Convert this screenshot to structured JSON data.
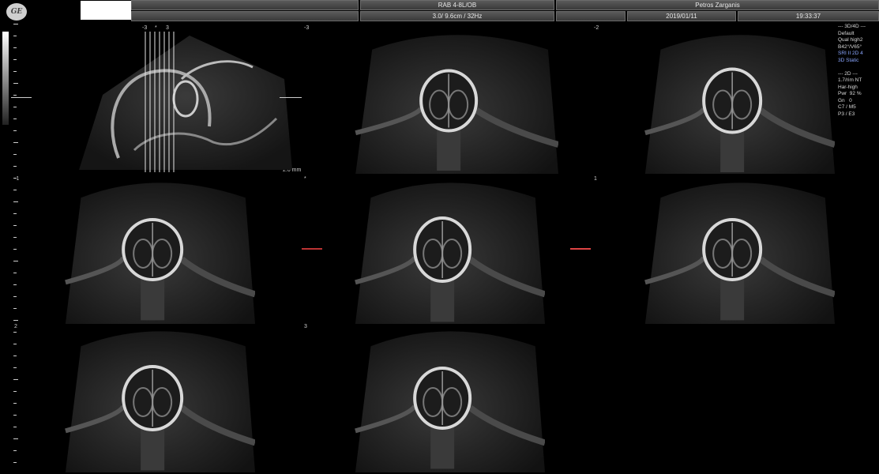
{
  "header": {
    "logo": "GE",
    "probe": "RAB 4-8L/OB",
    "depth": "3.0/ 9.6cm / 32Hz",
    "patient": "Petros  Zarganis",
    "date": "2019/01/11",
    "time": "19:33:37"
  },
  "colors": {
    "header_bg": "#4a4a4a",
    "accent_blue": "#8aa6ff",
    "ref_line": "#b33333"
  },
  "panels": [
    {
      "index": "-3",
      "type": "sagittal-reference"
    },
    {
      "index": "-3"
    },
    {
      "index": "-2"
    },
    {
      "index": "-1"
    },
    {
      "index": "*"
    },
    {
      "index": "1"
    },
    {
      "index": "2"
    },
    {
      "index": "3"
    }
  ],
  "reference_marks": [
    "-3",
    "*",
    "3"
  ],
  "slice_spacing": "2.0 mm",
  "info_panel": {
    "mode_3d": "--- 3D/4D ---",
    "preset": "Default",
    "quality": "Qual high2",
    "angles": "B42°/V65°",
    "sri": "SRI II 2D 4",
    "mode": "3D Static",
    "mode_2d": "--- 2D ---",
    "frequency": "1.7/rim NT",
    "harmonic": "Har-high",
    "power": "Pwr  92 %",
    "gain": "Gn   0",
    "c_m": "C7 / M5",
    "p_e": "P3 / E3"
  }
}
